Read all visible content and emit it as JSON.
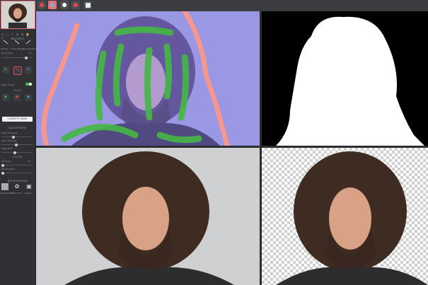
{
  "sidebar": {
    "brushes_title": "BRUSHES",
    "brush_labels": [
      "Pickers",
      "Color Range",
      "Transparency"
    ],
    "brush_size_label": "Brush Size",
    "brush_size_value": "70",
    "brush_size_level": 0.75,
    "magic_brush_label": "Magic Brush",
    "fills_title": "FILLS",
    "compute_label": "COMPUTE MASK",
    "adjustment_title": "ADJUSTMENT",
    "sliders": [
      {
        "label": "Edge Hardness",
        "level": 0.35
      },
      {
        "label": "Mask Strength",
        "level": 0.45
      },
      {
        "label": "Edge Shift",
        "level": 0.4
      }
    ],
    "color_title": "COLOR",
    "color_sliders": [
      {
        "label": "Recovery",
        "value": "0.0",
        "level": 0.02
      },
      {
        "label": "Desaturation",
        "level": 0.02
      }
    ],
    "background_title": "BACKGROUND",
    "bg_labels": [
      "Transparent",
      "Solid Color",
      "Image"
    ]
  },
  "colors": {
    "accent_red": "#e8474c",
    "mask_bg": "#9a97e4",
    "fg_stroke": "#45b845",
    "bg_stroke": "#f3978f"
  }
}
